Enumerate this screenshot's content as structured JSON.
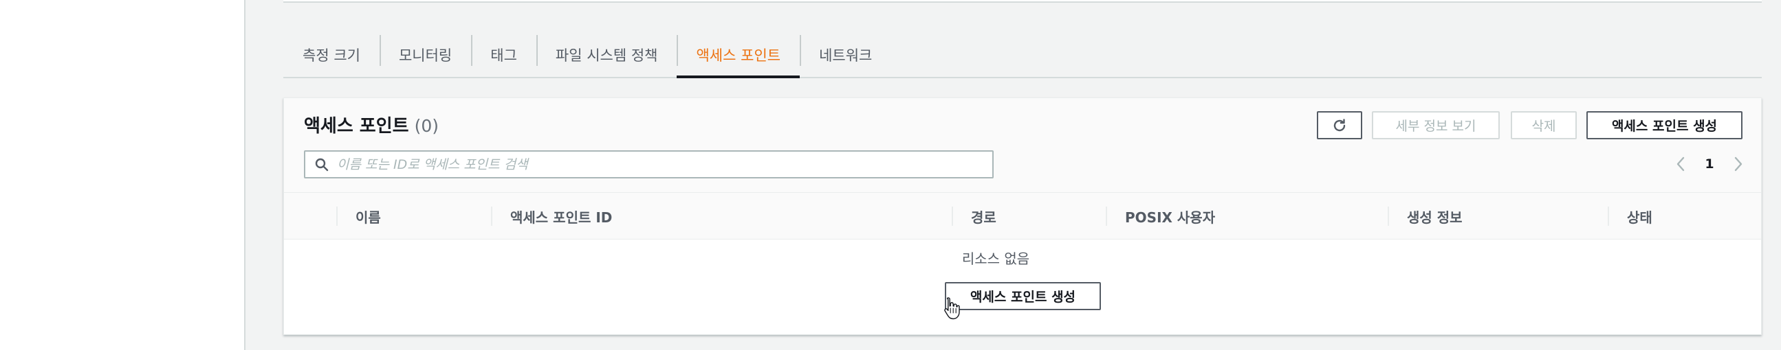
{
  "tabs": [
    {
      "label": "측정 크기"
    },
    {
      "label": "모니터링"
    },
    {
      "label": "태그"
    },
    {
      "label": "파일 시스템 정책"
    },
    {
      "label": "액세스 포인트",
      "active": true
    },
    {
      "label": "네트워크"
    }
  ],
  "panel": {
    "title": "액세스 포인트",
    "count": "(0)",
    "buttons": {
      "refresh_icon": "refresh-icon",
      "view_details": "세부 정보 보기",
      "delete": "삭제",
      "create": "액세스 포인트 생성"
    },
    "search": {
      "placeholder": "이름 또는 ID로 액세스 포인트 검색",
      "value": ""
    },
    "pagination": {
      "current_page": "1"
    },
    "columns": [
      "이름",
      "액세스 포인트 ID",
      "경로",
      "POSIX 사용자",
      "생성 정보",
      "상태"
    ],
    "empty": {
      "message": "리소스 없음",
      "create_button": "액세스 포인트 생성"
    }
  },
  "colors": {
    "accent": "#ec7211",
    "text": "#16191f",
    "muted": "#545b64",
    "disabled": "#aab7b8",
    "border": "#d5dbdb",
    "background": "#f2f3f3"
  }
}
